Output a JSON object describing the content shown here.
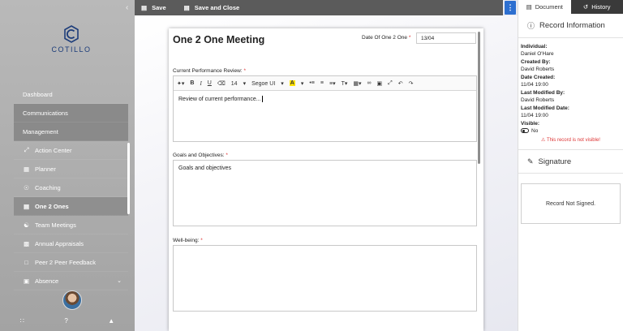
{
  "sidebar": {
    "logo_text": "COTILLO",
    "items": [
      {
        "label": "Dashboard"
      },
      {
        "label": "Communications"
      },
      {
        "label": "Management"
      },
      {
        "label": "Action Center",
        "icon": "expand-icon"
      },
      {
        "label": "Planner",
        "icon": "calendar-icon"
      },
      {
        "label": "Coaching",
        "icon": "compass-icon"
      },
      {
        "label": "One 2 Ones",
        "icon": "one-to-one-icon"
      },
      {
        "label": "Team Meetings",
        "icon": "users-icon"
      },
      {
        "label": "Annual Appraisals",
        "icon": "chart-icon"
      },
      {
        "label": "Peer 2 Peer Feedback",
        "icon": "chat-icon"
      },
      {
        "label": "Absence",
        "icon": "briefcase-icon"
      }
    ]
  },
  "toolbar": {
    "save_label": "Save",
    "save_close_label": "Save and Close"
  },
  "document": {
    "title": "One 2 One Meeting",
    "date_label": "Date Of One 2 One",
    "date_value": "13/04",
    "fields": [
      {
        "label": "Current Performance Review:",
        "content": "Review of current performance..."
      },
      {
        "label": "Goals and Objectives:",
        "content": "Goals and objectives"
      },
      {
        "label": "Well-being:",
        "content": ""
      }
    ],
    "rte": {
      "font_size": "14",
      "font_family": "Segoe UI"
    }
  },
  "rpanel": {
    "tab_document": "Document",
    "tab_history": "History",
    "record_title": "Record Information",
    "individual_label": "Individual:",
    "individual_value": "Daniel O'Hare",
    "created_by_label": "Created By:",
    "created_by_value": "David Roberts",
    "date_created_label": "Date Created:",
    "date_created_value": "11/04  19:00",
    "last_modified_by_label": "Last Modified By:",
    "last_modified_by_value": "David Roberts",
    "last_modified_date_label": "Last Modified Date:",
    "last_modified_date_value": "11/04  19:00",
    "visible_label": "Visible:",
    "visible_value": "No",
    "visible_warning": "This record is not visible!",
    "signature_title": "Signature",
    "signature_status": "Record Not Signed."
  },
  "colors": {
    "sidebar": "#a8a8a8",
    "toolbar": "#5b5b5b",
    "info_button": "#2d6fd0",
    "warning": "#d33333"
  }
}
